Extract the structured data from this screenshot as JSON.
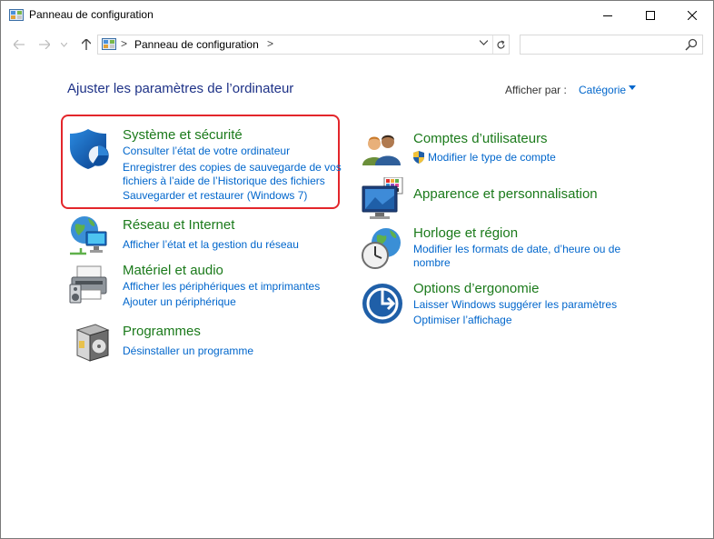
{
  "window": {
    "title": "Panneau de configuration"
  },
  "navbar": {
    "address_separator": ">",
    "address_path": "Panneau de configuration",
    "search_placeholder": ""
  },
  "content": {
    "heading": "Ajuster les paramètres de l’ordinateur",
    "view_by_label": "Afficher par :",
    "view_by_value": "Catégorie"
  },
  "categories": {
    "system": {
      "title": "Système et sécurité",
      "links": [
        "Consulter l’état de votre ordinateur",
        "Enregistrer des copies de sauvegarde de vos",
        "fichiers à l’aide de l’Historique des fichiers",
        "Sauvegarder et restaurer (Windows 7)"
      ]
    },
    "network": {
      "title": "Réseau et Internet",
      "links": [
        "Afficher l’état et la gestion du réseau"
      ]
    },
    "hardware": {
      "title": "Matériel et audio",
      "links": [
        "Afficher les périphériques et imprimantes",
        "Ajouter un périphérique"
      ]
    },
    "programs": {
      "title": "Programmes",
      "links": [
        "Désinstaller un programme"
      ]
    },
    "accounts": {
      "title": "Comptes d’utilisateurs",
      "links": [
        "Modifier le type de compte"
      ]
    },
    "appearance": {
      "title": "Apparence et personnalisation",
      "links": []
    },
    "clock": {
      "title": "Horloge et région",
      "links": [
        "Modifier les formats de date, d’heure ou de",
        "nombre"
      ]
    },
    "ease": {
      "title": "Options d’ergonomie",
      "links": [
        "Laisser Windows suggérer les paramètres",
        "Optimiser l’affichage"
      ]
    }
  },
  "colors": {
    "heading": "#1e3287",
    "category_title": "#1b7a1b",
    "link": "#0066cc",
    "highlight_border": "#e3262b"
  }
}
